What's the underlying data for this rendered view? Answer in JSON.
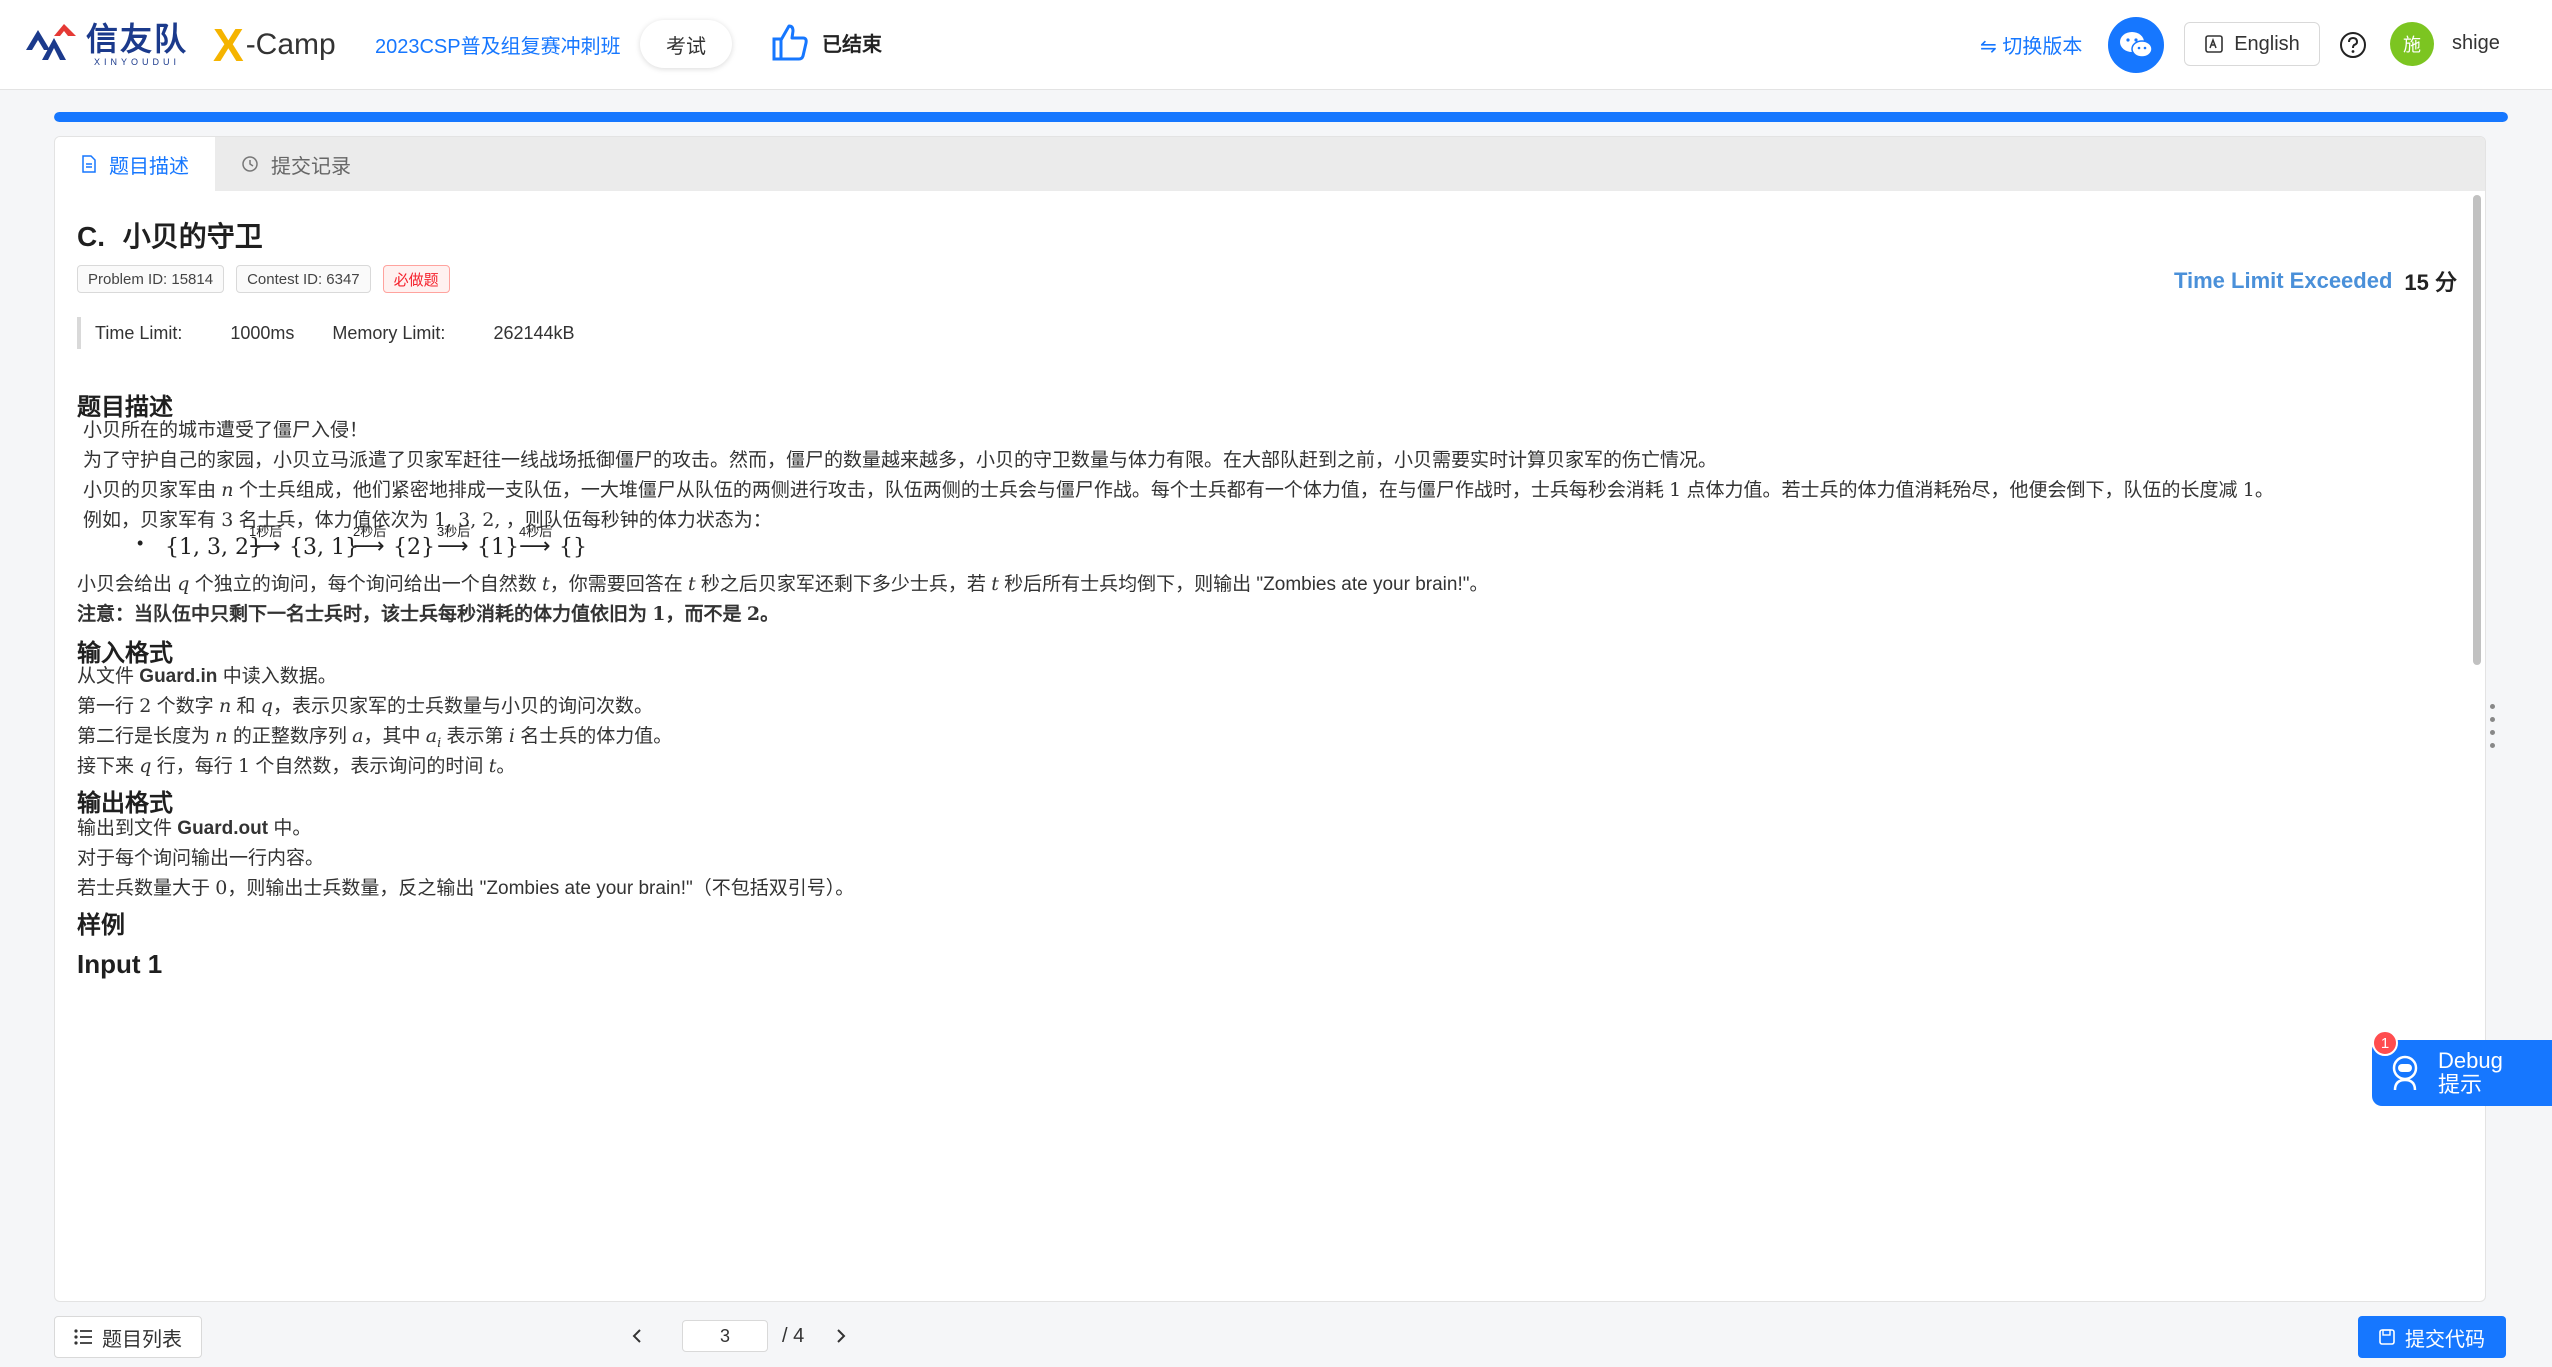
{
  "header": {
    "brand_cn": "信友队",
    "brand_en": "XINYOUDUI",
    "brand2_x": "X",
    "brand2_camp": "-Camp",
    "contest_name": "2023CSP普及组复赛冲刺班",
    "exam_label": "考试",
    "status_label": "已结束",
    "switch_version": "⇋ 切换版本",
    "language": "English",
    "avatar_char": "施",
    "username": "shige"
  },
  "progress": {
    "percent": 100
  },
  "tabs": [
    {
      "label": "题目描述",
      "active": true
    },
    {
      "label": "提交记录",
      "active": false
    }
  ],
  "problem": {
    "letter": "C.",
    "title": "小贝的守卫",
    "problem_id": "Problem ID: 15814",
    "contest_id": "Contest ID: 6347",
    "required_tag": "必做题",
    "verdict": "Time Limit Exceeded",
    "score": "15 分",
    "time_limit_label": "Time Limit:",
    "time_limit": "1000ms",
    "memory_limit_label": "Memory Limit:",
    "memory_limit": "262144kB"
  },
  "description": {
    "heading": "题目描述",
    "p1": "小贝所在的城市遭受了僵尸入侵！",
    "p2": "为了守护自己的家园，小贝立马派遣了贝家军赶往一线战场抵御僵尸的攻击。然而，僵尸的数量越来越多，小贝的守卫数量与体力有限。在大部队赶到之前，小贝需要实时计算贝家军的伤亡情况。",
    "p3a": "小贝的贝家军由",
    "p3b": "个士兵组成，他们紧密地排成一支队伍，一大堆僵尸从队伍的两侧进行攻击，队伍两侧的士兵会与僵尸作战。每个士兵都有一个体力值，在与僵尸作战时，士兵每秒会消耗",
    "p3c": "点体力值。若士兵的体力值消耗殆尽，他便会倒下，队伍的长度减",
    "p3d": "。",
    "p4a": "例如，贝家军有",
    "p4b": "名士兵，体力值依次为",
    "p4c": "，则队伍每秒钟的体力状态为：",
    "example_sets": [
      "{1, 3, 2}",
      "{3, 1}",
      "{2}",
      "{1}",
      "{}"
    ],
    "example_arrows": [
      "1秒后",
      "2秒后",
      "3秒后",
      "4秒后"
    ],
    "p5a": "小贝会给出",
    "p5b": "个独立的询问，每个询问给出一个自然数",
    "p5c": "，你需要回答在",
    "p5d": "秒之后贝家军还剩下多少士兵，若",
    "p5e": "秒后所有士兵均倒下，则输出 \"Zombies ate your brain!\"。",
    "note_a": "注意：当队伍中只剩下一名士兵时，该士兵每秒消耗的体力值依旧为",
    "note_b": "，而不是",
    "note_c": "。"
  },
  "input_format": {
    "heading": "输入格式",
    "p1a": "从文件",
    "p1_file": "Guard.in",
    "p1b": "中读入数据。",
    "p2a": "第一行",
    "p2b": "个数字",
    "p2c": "和",
    "p2d": "，表示贝家军的士兵数量与小贝的询问次数。",
    "p3a": "第二行是长度为",
    "p3b": "的正整数序列",
    "p3c": "，其中",
    "p3d": "表示第",
    "p3e": "名士兵的体力值。",
    "p4a": "接下来",
    "p4b": "行，每行",
    "p4c": "个自然数，表示询问的时间",
    "p4d": "。"
  },
  "output_format": {
    "heading": "输出格式",
    "p1a": "输出到文件",
    "p1_file": "Guard.out",
    "p1b": "中。",
    "p2": "对于每个询问输出一行内容。",
    "p3a": "若士兵数量大于",
    "p3b": "，则输出士兵数量，反之输出 \"Zombies ate your brain!\"（不包括双引号）。"
  },
  "sample": {
    "heading": "样例",
    "input_heading": "Input 1"
  },
  "math": {
    "n": "n",
    "q": "q",
    "t": "t",
    "a": "a",
    "a_i": "a",
    "i_sub": "i",
    "i": "i",
    "one": "1",
    "two": "2",
    "three": "3",
    "zero": "0",
    "seq": "1, 3, 2,"
  },
  "bottom": {
    "list_label": "题目列表",
    "page_current": "3",
    "page_total": "/ 4",
    "submit_label": "提交代码"
  },
  "debug": {
    "badge": "1",
    "line1": "Debug",
    "line2": "提示"
  },
  "colors": {
    "accent": "#1677ff",
    "verdict": "#4a90d9",
    "danger": "#f5222d"
  }
}
